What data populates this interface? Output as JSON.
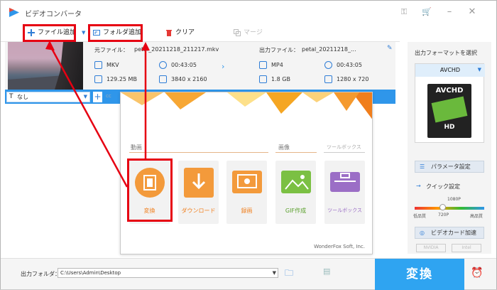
{
  "app": {
    "title": "ビデオコンバータ"
  },
  "toolbar": {
    "add_file": "ファイル追加",
    "add_folder": "フォルダ追加",
    "clear": "クリア",
    "merge": "マージ"
  },
  "file": {
    "source_label": "元ファイル：",
    "source_name": "petal_20211218_211217.mkv",
    "source_format": "MKV",
    "source_duration": "00:43:05",
    "source_size": "129.25 MB",
    "source_resolution": "3840 x 2160",
    "output_label": "出力ファイル：",
    "output_name": "petal_20211218_...",
    "output_format": "MP4",
    "output_duration": "00:43:05",
    "output_size": "1.8 GB",
    "output_resolution": "1280 x 720"
  },
  "subtitle": {
    "value": "なし",
    "cc": "cc"
  },
  "popup": {
    "section_video": "動画",
    "section_image": "画像",
    "section_toolbox": "ツールボックス",
    "cards": [
      {
        "label": "変換",
        "icon": "film-icon"
      },
      {
        "label": "ダウンロード",
        "icon": "download-icon"
      },
      {
        "label": "録画",
        "icon": "screen-record-icon"
      },
      {
        "label": "GIF作成",
        "icon": "image-icon"
      },
      {
        "label": "ツールボックス",
        "icon": "toolbox-icon"
      }
    ],
    "footer": "WonderFox Soft, Inc."
  },
  "right": {
    "title": "出力フォーマットを選択",
    "format": "AVCHD",
    "format_badge_top": "AVCHD",
    "format_badge_bottom": "HD",
    "param_btn": "パラメータ設定",
    "quick": "クイック設定",
    "slider_top": "1080P",
    "slider_low": "低品質",
    "slider_mid": "720P",
    "slider_high": "高品質",
    "gpu_btn": "ビデオカード加速",
    "nvidia": "NVIDIA",
    "intel": "Intel"
  },
  "bottom": {
    "output_folder_label": "出力フォルダ：",
    "output_path": "C:\\Users\\Admin\\Desktop",
    "run": "変換"
  },
  "colors": {
    "accent": "#2f96ea",
    "orange": "#f07e1c",
    "highlight": "#e60012"
  }
}
